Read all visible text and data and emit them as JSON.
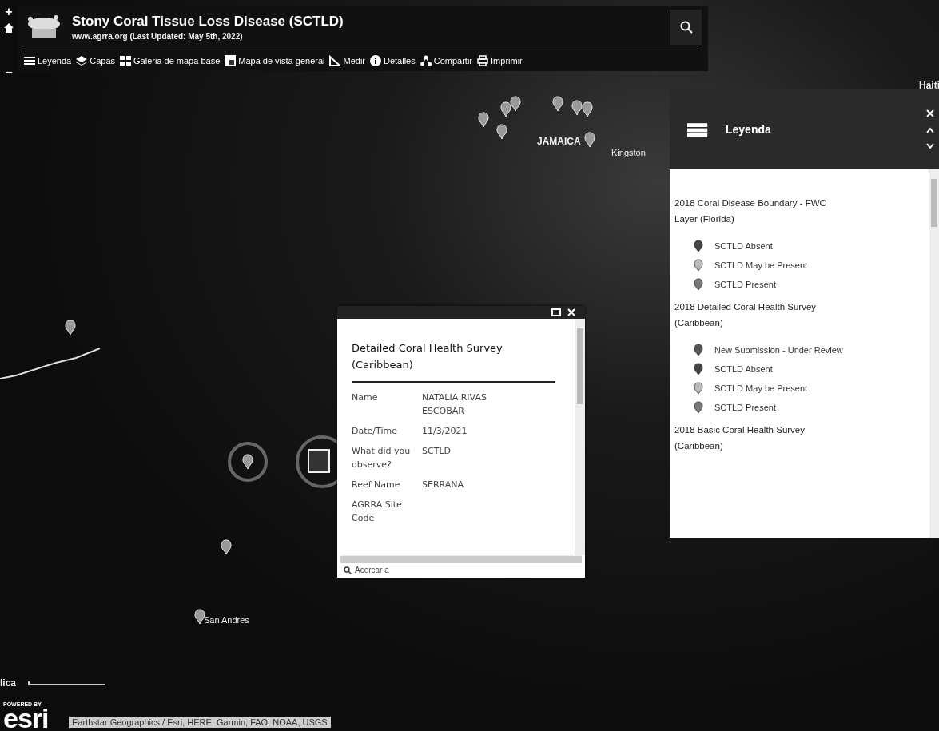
{
  "header": {
    "title": "Stony Coral Tissue Loss Disease (SCTLD)",
    "subtitle": "www.agrra.org (Last Updated: May 5th, 2022)"
  },
  "toolbar": [
    {
      "label": "Leyenda",
      "kind": "list"
    },
    {
      "label": "Capas",
      "kind": "layers"
    },
    {
      "label": "Galeria de mapa base",
      "kind": "grid"
    },
    {
      "label": "Mapa de vista general",
      "kind": "overview"
    },
    {
      "label": "Medir",
      "kind": "measure"
    },
    {
      "label": "Detalles",
      "kind": "info"
    },
    {
      "label": "Compartir",
      "kind": "share"
    },
    {
      "label": "Imprimir",
      "kind": "print"
    }
  ],
  "map_labels": [
    {
      "text": "Haiti",
      "kind": "country"
    },
    {
      "text": "JAMAICA",
      "kind": "country"
    },
    {
      "text": "Kingston",
      "kind": "city"
    },
    {
      "text": "San Andres",
      "kind": "city"
    },
    {
      "text": "lica",
      "kind": "country"
    }
  ],
  "popup": {
    "title": "Detailed Coral Health Survey (Caribbean)",
    "fields": [
      {
        "label": "Name",
        "value": "NATALIA RIVAS ESCOBAR"
      },
      {
        "label": "Date/Time",
        "value": "11/3/2021"
      },
      {
        "label": "What did you observe?",
        "value": "SCTLD"
      },
      {
        "label": "Reef Name",
        "value": "SERRANA"
      },
      {
        "label": "AGRRA Site Code"
      }
    ],
    "action": "Acercar a"
  },
  "legend": {
    "title": "Leyenda",
    "groups": [
      {
        "title": "2018 Coral Disease Boundary - FWC Layer (Florida)",
        "items": [
          {
            "label": "SCTLD Absent",
            "color": "#444444"
          },
          {
            "label": "SCTLD May be Present",
            "color": "#bbbbbb"
          },
          {
            "label": "SCTLD Present",
            "color": "#777777"
          }
        ]
      },
      {
        "title": "2018 Detailed Coral Health Survey (Caribbean)",
        "items": [
          {
            "label": "New Submission - Under Review",
            "color": "#555555"
          },
          {
            "label": "SCTLD Absent",
            "color": "#444444"
          },
          {
            "label": "SCTLD May be Present",
            "color": "#bbbbbb"
          },
          {
            "label": "SCTLD Present",
            "color": "#777777"
          }
        ]
      },
      {
        "title": "2018 Basic Coral Health Survey (Caribbean)"
      }
    ]
  },
  "zoom_controls": {
    "zoom_in": "+",
    "zoom_out": "−"
  },
  "logo": {
    "tagline": "POWERED BY",
    "text": "esri"
  },
  "attribution": "Earthstar Geographics / Esri, HERE, Garmin, FAO, NOAA, USGS"
}
